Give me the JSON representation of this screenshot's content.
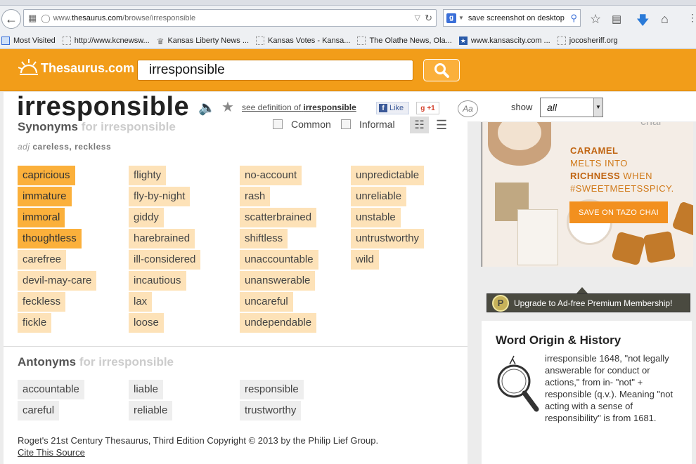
{
  "browser": {
    "url_prefix": "www.",
    "url_host": "thesaurus.com",
    "url_path": "/browse/irresponsible",
    "search_engine_text": "save screenshot on desktop",
    "bookmarks": [
      "Most Visited",
      "http://www.kcnewsw...",
      "Kansas Liberty News ...",
      "Kansas Votes - Kansa...",
      "The Olathe News, Ola...",
      "www.kansascity.com ...",
      "jocosheriff.org"
    ]
  },
  "site": {
    "logo_text": "Thesaurus.com",
    "search_value": "irresponsible"
  },
  "entry": {
    "word": "irresponsible",
    "see_def_prefix": "see definition of",
    "see_def_word": "irresponsible",
    "like_label": "Like",
    "gplus_label": "+1",
    "aa_label": "Aa",
    "show_label": "show",
    "show_value": "all",
    "synonyms_title": "Synonyms",
    "synonyms_for": "for irresponsible",
    "filter_common": "Common",
    "filter_informal": "Informal",
    "pos_abbr": "adj",
    "pos_words": "careless, reckless",
    "synonym_columns": [
      [
        "capricious",
        "immature",
        "immoral",
        "thoughtless",
        "carefree",
        "devil-may-care",
        "feckless",
        "fickle"
      ],
      [
        "flighty",
        "fly-by-night",
        "giddy",
        "harebrained",
        "ill-considered",
        "incautious",
        "lax",
        "loose"
      ],
      [
        "no-account",
        "rash",
        "scatterbrained",
        "shiftless",
        "unaccountable",
        "unanswerable",
        "uncareful",
        "undependable"
      ],
      [
        "unpredictable",
        "unreliable",
        "unstable",
        "untrustworthy",
        "wild"
      ]
    ],
    "antonyms_title": "Antonyms",
    "antonyms_for": "for irresponsible",
    "antonym_columns": [
      [
        "accountable",
        "careful"
      ],
      [
        "liable",
        "reliable"
      ],
      [
        "responsible",
        "trustworthy"
      ]
    ],
    "copyright": "Roget's 21st Century Thesaurus, Third Edition Copyright © 2013 by the Philip Lief Group.",
    "cite_label": "Cite This Source"
  },
  "ad": {
    "brand": "chai",
    "line1": "CARAMEL",
    "line2": "MELTS INTO",
    "line3a": "RICHNESS",
    "line3b": " WHEN",
    "line4": "#SWEETMEETSSPICY.",
    "button": "SAVE ON TAZO CHAI"
  },
  "upgrade": {
    "badge": "P",
    "label": "Upgrade to Ad-free Premium Membership!"
  },
  "origin": {
    "title": "Word Origin & History",
    "body": "irresponsible 1648, \"not legally answerable for conduct or actions,\" from in- \"not\" + responsible (q.v.). Meaning \"not acting with a sense of responsibility\" is from 1681."
  }
}
